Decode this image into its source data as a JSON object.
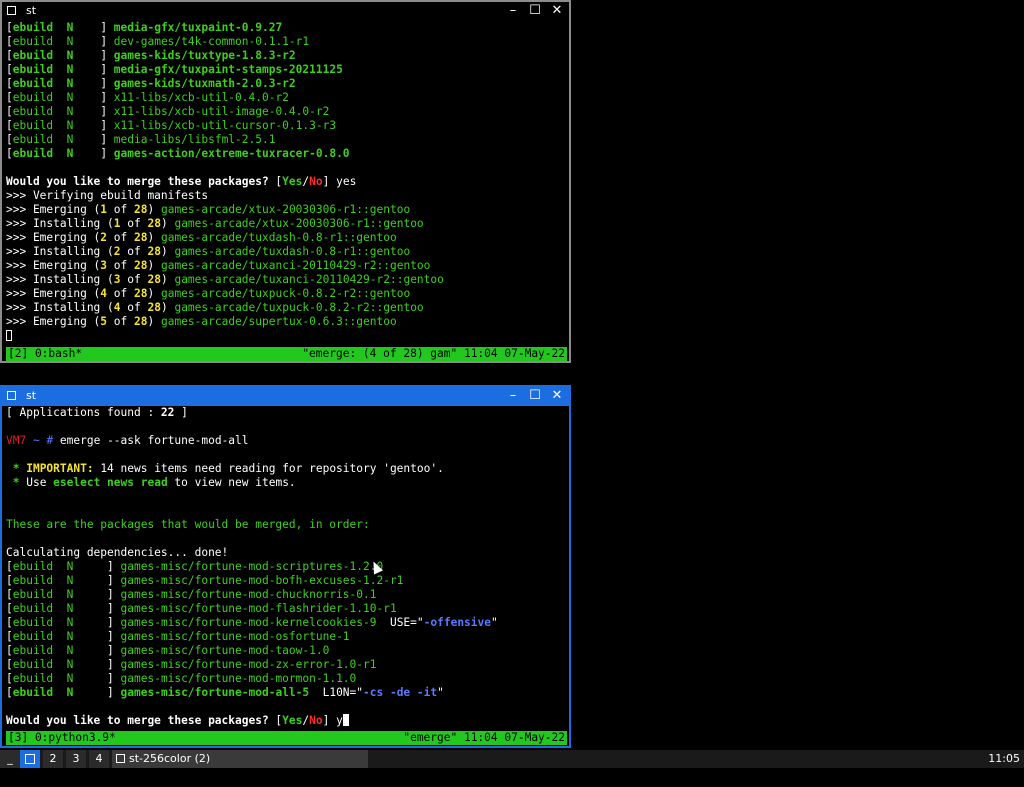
{
  "window1": {
    "title": "st",
    "lines": [
      [
        [
          "[",
          ""
        ],
        [
          "ebuild  N    ",
          "gb"
        ],
        [
          "] ",
          ""
        ],
        [
          "media-gfx/tuxpaint-0.9.27",
          "gb"
        ]
      ],
      [
        [
          "[",
          ""
        ],
        [
          "ebuild  N    ",
          "g"
        ],
        [
          "] ",
          ""
        ],
        [
          "dev-games/t4k-common-0.1.1-r1",
          "g"
        ]
      ],
      [
        [
          "[",
          ""
        ],
        [
          "ebuild  N    ",
          "gb"
        ],
        [
          "] ",
          ""
        ],
        [
          "games-kids/tuxtype-1.8.3-r2",
          "gb"
        ]
      ],
      [
        [
          "[",
          ""
        ],
        [
          "ebuild  N    ",
          "gb"
        ],
        [
          "] ",
          ""
        ],
        [
          "media-gfx/tuxpaint-stamps-20211125",
          "gb"
        ]
      ],
      [
        [
          "[",
          ""
        ],
        [
          "ebuild  N    ",
          "gb"
        ],
        [
          "] ",
          ""
        ],
        [
          "games-kids/tuxmath-2.0.3-r2",
          "gb"
        ]
      ],
      [
        [
          "[",
          ""
        ],
        [
          "ebuild  N    ",
          "g"
        ],
        [
          "] ",
          ""
        ],
        [
          "x11-libs/xcb-util-0.4.0-r2",
          "g"
        ]
      ],
      [
        [
          "[",
          ""
        ],
        [
          "ebuild  N    ",
          "g"
        ],
        [
          "] ",
          ""
        ],
        [
          "x11-libs/xcb-util-image-0.4.0-r2",
          "g"
        ]
      ],
      [
        [
          "[",
          ""
        ],
        [
          "ebuild  N    ",
          "g"
        ],
        [
          "] ",
          ""
        ],
        [
          "x11-libs/xcb-util-cursor-0.1.3-r3",
          "g"
        ]
      ],
      [
        [
          "[",
          ""
        ],
        [
          "ebuild  N    ",
          "g"
        ],
        [
          "] ",
          ""
        ],
        [
          "media-libs/libsfml-2.5.1",
          "g"
        ]
      ],
      [
        [
          "[",
          ""
        ],
        [
          "ebuild  N    ",
          "gb"
        ],
        [
          "] ",
          ""
        ],
        [
          "games-action/extreme-tuxracer-0.8.0",
          "gb"
        ]
      ],
      [],
      [
        [
          "Would you like to merge these packages? ",
          "b"
        ],
        [
          "[",
          ""
        ],
        [
          "Yes",
          "gb"
        ],
        [
          "/",
          ""
        ],
        [
          "No",
          "r"
        ],
        [
          "] yes",
          ""
        ]
      ],
      [
        [
          ">>> Verifying ebuild manifests",
          ""
        ]
      ],
      [
        [
          ">>> Emerging (",
          ""
        ],
        [
          "1",
          "y"
        ],
        [
          " of ",
          ""
        ],
        [
          "28",
          "y"
        ],
        [
          ") ",
          ""
        ],
        [
          "games-arcade/xtux-20030306-r1::gentoo",
          "g"
        ]
      ],
      [
        [
          ">>> Installing (",
          ""
        ],
        [
          "1",
          "y"
        ],
        [
          " of ",
          ""
        ],
        [
          "28",
          "y"
        ],
        [
          ") ",
          ""
        ],
        [
          "games-arcade/xtux-20030306-r1::gentoo",
          "g"
        ]
      ],
      [
        [
          ">>> Emerging (",
          ""
        ],
        [
          "2",
          "y"
        ],
        [
          " of ",
          ""
        ],
        [
          "28",
          "y"
        ],
        [
          ") ",
          ""
        ],
        [
          "games-arcade/tuxdash-0.8-r1::gentoo",
          "g"
        ]
      ],
      [
        [
          ">>> Installing (",
          ""
        ],
        [
          "2",
          "y"
        ],
        [
          " of ",
          ""
        ],
        [
          "28",
          "y"
        ],
        [
          ") ",
          ""
        ],
        [
          "games-arcade/tuxdash-0.8-r1::gentoo",
          "g"
        ]
      ],
      [
        [
          ">>> Emerging (",
          ""
        ],
        [
          "3",
          "y"
        ],
        [
          " of ",
          ""
        ],
        [
          "28",
          "y"
        ],
        [
          ") ",
          ""
        ],
        [
          "games-arcade/tuxanci-20110429-r2::gentoo",
          "g"
        ]
      ],
      [
        [
          ">>> Installing (",
          ""
        ],
        [
          "3",
          "y"
        ],
        [
          " of ",
          ""
        ],
        [
          "28",
          "y"
        ],
        [
          ") ",
          ""
        ],
        [
          "games-arcade/tuxanci-20110429-r2::gentoo",
          "g"
        ]
      ],
      [
        [
          ">>> Emerging (",
          ""
        ],
        [
          "4",
          "y"
        ],
        [
          " of ",
          ""
        ],
        [
          "28",
          "y"
        ],
        [
          ") ",
          ""
        ],
        [
          "games-arcade/tuxpuck-0.8.2-r2::gentoo",
          "g"
        ]
      ],
      [
        [
          ">>> Installing (",
          ""
        ],
        [
          "4",
          "y"
        ],
        [
          " of ",
          ""
        ],
        [
          "28",
          "y"
        ],
        [
          ") ",
          ""
        ],
        [
          "games-arcade/tuxpuck-0.8.2-r2::gentoo",
          "g"
        ]
      ],
      [
        [
          ">>> Emerging (",
          ""
        ],
        [
          "5",
          "y"
        ],
        [
          " of ",
          ""
        ],
        [
          "28",
          "y"
        ],
        [
          ") ",
          ""
        ],
        [
          "games-arcade/supertux-0.6.3::gentoo",
          "g"
        ]
      ]
    ],
    "status_left": "[2] 0:bash*",
    "status_right": "\"emerge: (4 of 28) gam\" 11:04 07-May-22"
  },
  "window2": {
    "title": "st",
    "lines": [
      [
        [
          "[ Applications found : ",
          ""
        ],
        [
          "22",
          "b"
        ],
        [
          " ]",
          ""
        ]
      ],
      [],
      [
        [
          "VM7",
          "rd"
        ],
        [
          " ~ ",
          "bla"
        ],
        [
          "# ",
          "bla"
        ],
        [
          "emerge --ask fortune-mod-all",
          ""
        ]
      ],
      [],
      [
        [
          " * ",
          "gb"
        ],
        [
          "IMPORTANT:",
          "y"
        ],
        [
          " 14 news items need reading for repository 'gentoo'.",
          ""
        ]
      ],
      [
        [
          " * ",
          "gb"
        ],
        [
          "Use ",
          ""
        ],
        [
          "eselect news read",
          "gb"
        ],
        [
          " to view new items.",
          ""
        ]
      ],
      [],
      [],
      [
        [
          "These are the packages that would be merged, in order:",
          "g"
        ]
      ],
      [],
      [
        [
          "Calculating dependencies... done!",
          ""
        ]
      ],
      [
        [
          "[",
          ""
        ],
        [
          "ebuild  N     ",
          "g"
        ],
        [
          "] ",
          ""
        ],
        [
          "games-misc/fortune-mod-scriptures-1.2.0",
          "g"
        ]
      ],
      [
        [
          "[",
          ""
        ],
        [
          "ebuild  N     ",
          "g"
        ],
        [
          "] ",
          ""
        ],
        [
          "games-misc/fortune-mod-bofh-excuses-1.2-r1",
          "g"
        ]
      ],
      [
        [
          "[",
          ""
        ],
        [
          "ebuild  N     ",
          "g"
        ],
        [
          "] ",
          ""
        ],
        [
          "games-misc/fortune-mod-chucknorris-0.1",
          "g"
        ]
      ],
      [
        [
          "[",
          ""
        ],
        [
          "ebuild  N     ",
          "g"
        ],
        [
          "] ",
          ""
        ],
        [
          "games-misc/fortune-mod-flashrider-1.10-r1",
          "g"
        ]
      ],
      [
        [
          "[",
          ""
        ],
        [
          "ebuild  N     ",
          "g"
        ],
        [
          "] ",
          ""
        ],
        [
          "games-misc/fortune-mod-kernelcookies-9",
          "g"
        ],
        [
          "  USE=\"",
          ""
        ],
        [
          "-offensive",
          "bl"
        ],
        [
          "\"",
          ""
        ]
      ],
      [
        [
          "[",
          ""
        ],
        [
          "ebuild  N     ",
          "g"
        ],
        [
          "] ",
          ""
        ],
        [
          "games-misc/fortune-mod-osfortune-1",
          "g"
        ]
      ],
      [
        [
          "[",
          ""
        ],
        [
          "ebuild  N     ",
          "g"
        ],
        [
          "] ",
          ""
        ],
        [
          "games-misc/fortune-mod-taow-1.0",
          "g"
        ]
      ],
      [
        [
          "[",
          ""
        ],
        [
          "ebuild  N     ",
          "g"
        ],
        [
          "] ",
          ""
        ],
        [
          "games-misc/fortune-mod-zx-error-1.0-r1",
          "g"
        ]
      ],
      [
        [
          "[",
          ""
        ],
        [
          "ebuild  N     ",
          "g"
        ],
        [
          "] ",
          ""
        ],
        [
          "games-misc/fortune-mod-mormon-1.1.0",
          "g"
        ]
      ],
      [
        [
          "[",
          ""
        ],
        [
          "ebuild  N     ",
          "gb"
        ],
        [
          "] ",
          ""
        ],
        [
          "games-misc/fortune-mod-all-5",
          "gb"
        ],
        [
          "  L10N=\"",
          ""
        ],
        [
          "-cs -de -it",
          "bl"
        ],
        [
          "\"",
          ""
        ]
      ],
      [],
      [
        [
          "Would you like to merge these packages? ",
          "b"
        ],
        [
          "[",
          ""
        ],
        [
          "Yes",
          "gb"
        ],
        [
          "/",
          ""
        ],
        [
          "No",
          "r"
        ],
        [
          "] y",
          ""
        ]
      ]
    ],
    "status_left": "[3] 0:python3.9*",
    "status_right": "\"emerge\" 11:04 07-May-22"
  },
  "taskbar": {
    "workspaces": [
      "_",
      "",
      "2",
      "3",
      "4"
    ],
    "task_label": "st-256color (2)",
    "clock": "11:05"
  }
}
